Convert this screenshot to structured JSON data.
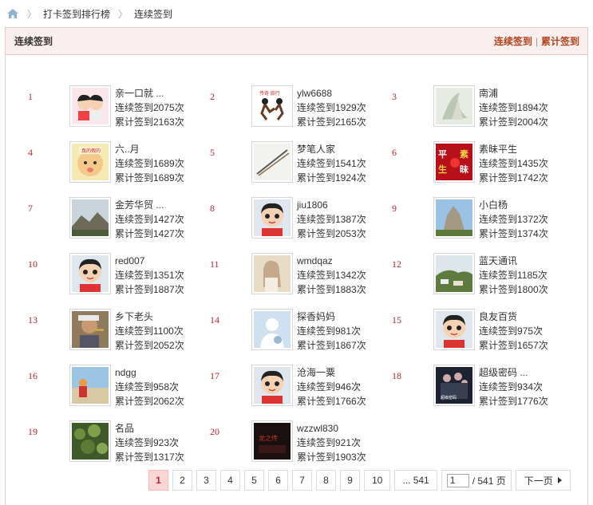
{
  "breadcrumb": {
    "home_icon": "home-icon",
    "items": [
      "打卡签到排行榜",
      "连续签到"
    ]
  },
  "panel": {
    "title": "连续签到",
    "links": [
      "连续签到",
      "累计签到"
    ]
  },
  "ranking": [
    {
      "rank": "1",
      "name": "亲一口就 ...",
      "consecutive": "连续签到2075次",
      "total": "累计签到2163次",
      "avatar": "kissing-kids"
    },
    {
      "rank": "2",
      "name": "ylw6688",
      "consecutive": "连续签到1929次",
      "total": "累计签到2165次",
      "avatar": "dancers"
    },
    {
      "rank": "3",
      "name": "南浦",
      "consecutive": "连续签到1894次",
      "total": "累计签到2004次",
      "avatar": "sketch"
    },
    {
      "rank": "4",
      "name": "六..月",
      "consecutive": "连续签到1689次",
      "total": "累计签到1689次",
      "avatar": "baby"
    },
    {
      "rank": "5",
      "name": "梦笔人家",
      "consecutive": "连续签到1541次",
      "total": "累计签到1924次",
      "avatar": "brush"
    },
    {
      "rank": "6",
      "name": "素昧平生",
      "consecutive": "连续签到1435次",
      "total": "累计签到1742次",
      "avatar": "red-poster"
    },
    {
      "rank": "7",
      "name": "金芳华贸 ...",
      "consecutive": "连续签到1427次",
      "total": "累计签到1427次",
      "avatar": "mountain"
    },
    {
      "rank": "8",
      "name": "jiu1806",
      "consecutive": "连续签到1387次",
      "total": "累计签到2053次",
      "avatar": "default"
    },
    {
      "rank": "9",
      "name": "小白杨",
      "consecutive": "连续签到1372次",
      "total": "累计签到1374次",
      "avatar": "rock"
    },
    {
      "rank": "10",
      "name": "red007",
      "consecutive": "连续签到1351次",
      "total": "累计签到1887次",
      "avatar": "default"
    },
    {
      "rank": "11",
      "name": "wmdqaz",
      "consecutive": "连续签到1342次",
      "total": "累计签到1883次",
      "avatar": "girl"
    },
    {
      "rank": "12",
      "name": "蓝天通讯",
      "consecutive": "连续签到1185次",
      "total": "累计签到1800次",
      "avatar": "hill"
    },
    {
      "rank": "13",
      "name": "乡下老头",
      "consecutive": "连续签到1100次",
      "total": "累计签到2052次",
      "avatar": "old-man"
    },
    {
      "rank": "14",
      "name": "探香妈妈",
      "consecutive": "连续签到981次",
      "total": "累计签到1867次",
      "avatar": "blank"
    },
    {
      "rank": "15",
      "name": "良友百货",
      "consecutive": "连续签到975次",
      "total": "累计签到1657次",
      "avatar": "default"
    },
    {
      "rank": "16",
      "name": "ndgg",
      "consecutive": "连续签到958次",
      "total": "累计签到2062次",
      "avatar": "beach"
    },
    {
      "rank": "17",
      "name": "沧海一粟",
      "consecutive": "连续签到946次",
      "total": "累计签到1766次",
      "avatar": "default"
    },
    {
      "rank": "18",
      "name": "超级密码 ...",
      "consecutive": "连续签到934次",
      "total": "累计签到1776次",
      "avatar": "crowd"
    },
    {
      "rank": "19",
      "name": "名品",
      "consecutive": "连续签到923次",
      "total": "累计签到1317次",
      "avatar": "plants"
    },
    {
      "rank": "20",
      "name": "wzzwl830",
      "consecutive": "连续签到921次",
      "total": "累计签到1903次",
      "avatar": "dark-poster"
    }
  ],
  "pagination": {
    "pages": [
      "1",
      "2",
      "3",
      "4",
      "5",
      "6",
      "7",
      "8",
      "9",
      "10"
    ],
    "current": "1",
    "last": "... 541",
    "input_value": "1",
    "total_label": "/ 541 页",
    "next_label": "下一页"
  },
  "colors": {
    "accent_red": "#c0242b",
    "link_orange": "#b5421c",
    "header_bg": "#fbeeee"
  }
}
